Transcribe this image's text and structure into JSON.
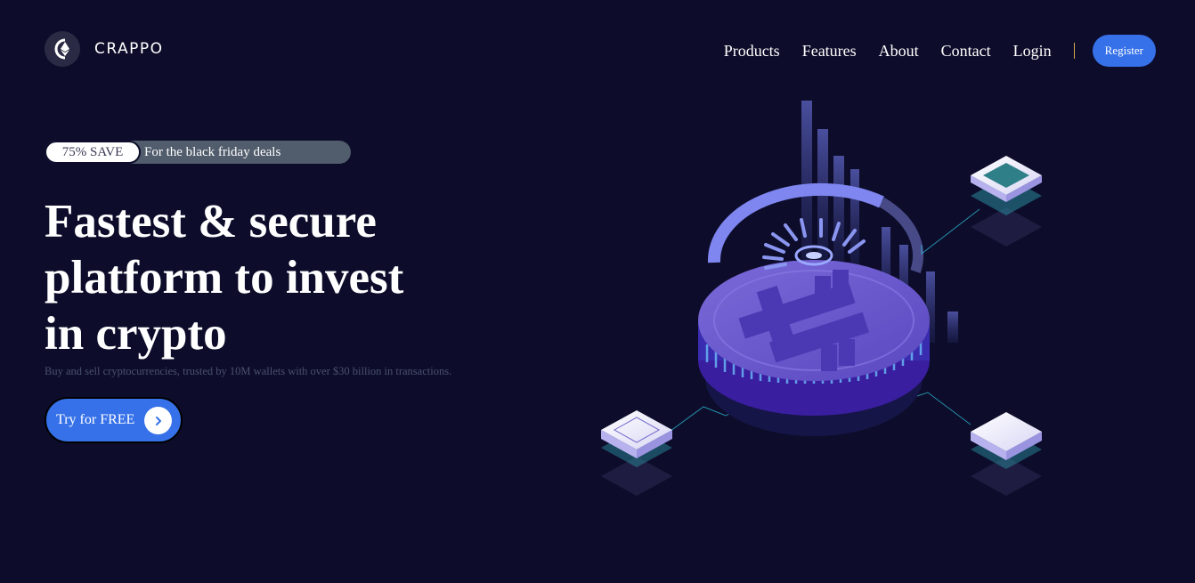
{
  "header": {
    "brand": "CRAPPO",
    "logo_icon": "ethereum-icon",
    "nav": [
      "Products",
      "Features",
      "About",
      "Contact",
      "Login"
    ],
    "register_label": "Register"
  },
  "hero": {
    "promo_badge": "75% SAVE",
    "promo_text": "For the black friday deals",
    "title_lines": [
      "Fastest & secure",
      "platform to invest",
      "in crypto"
    ],
    "subtitle": "Buy and sell cryptocurrencies, trusted by 10M wallets with over $30 billion in transactions.",
    "cta_label": "Try for FREE",
    "cta_icon": "chevron-right-icon",
    "illustration_icon": "bitcoin-icon"
  },
  "colors": {
    "background": "#0d0d2b",
    "accent": "#3671e9",
    "promo_track": "#515c6c",
    "coin": "#6c5ccf"
  }
}
